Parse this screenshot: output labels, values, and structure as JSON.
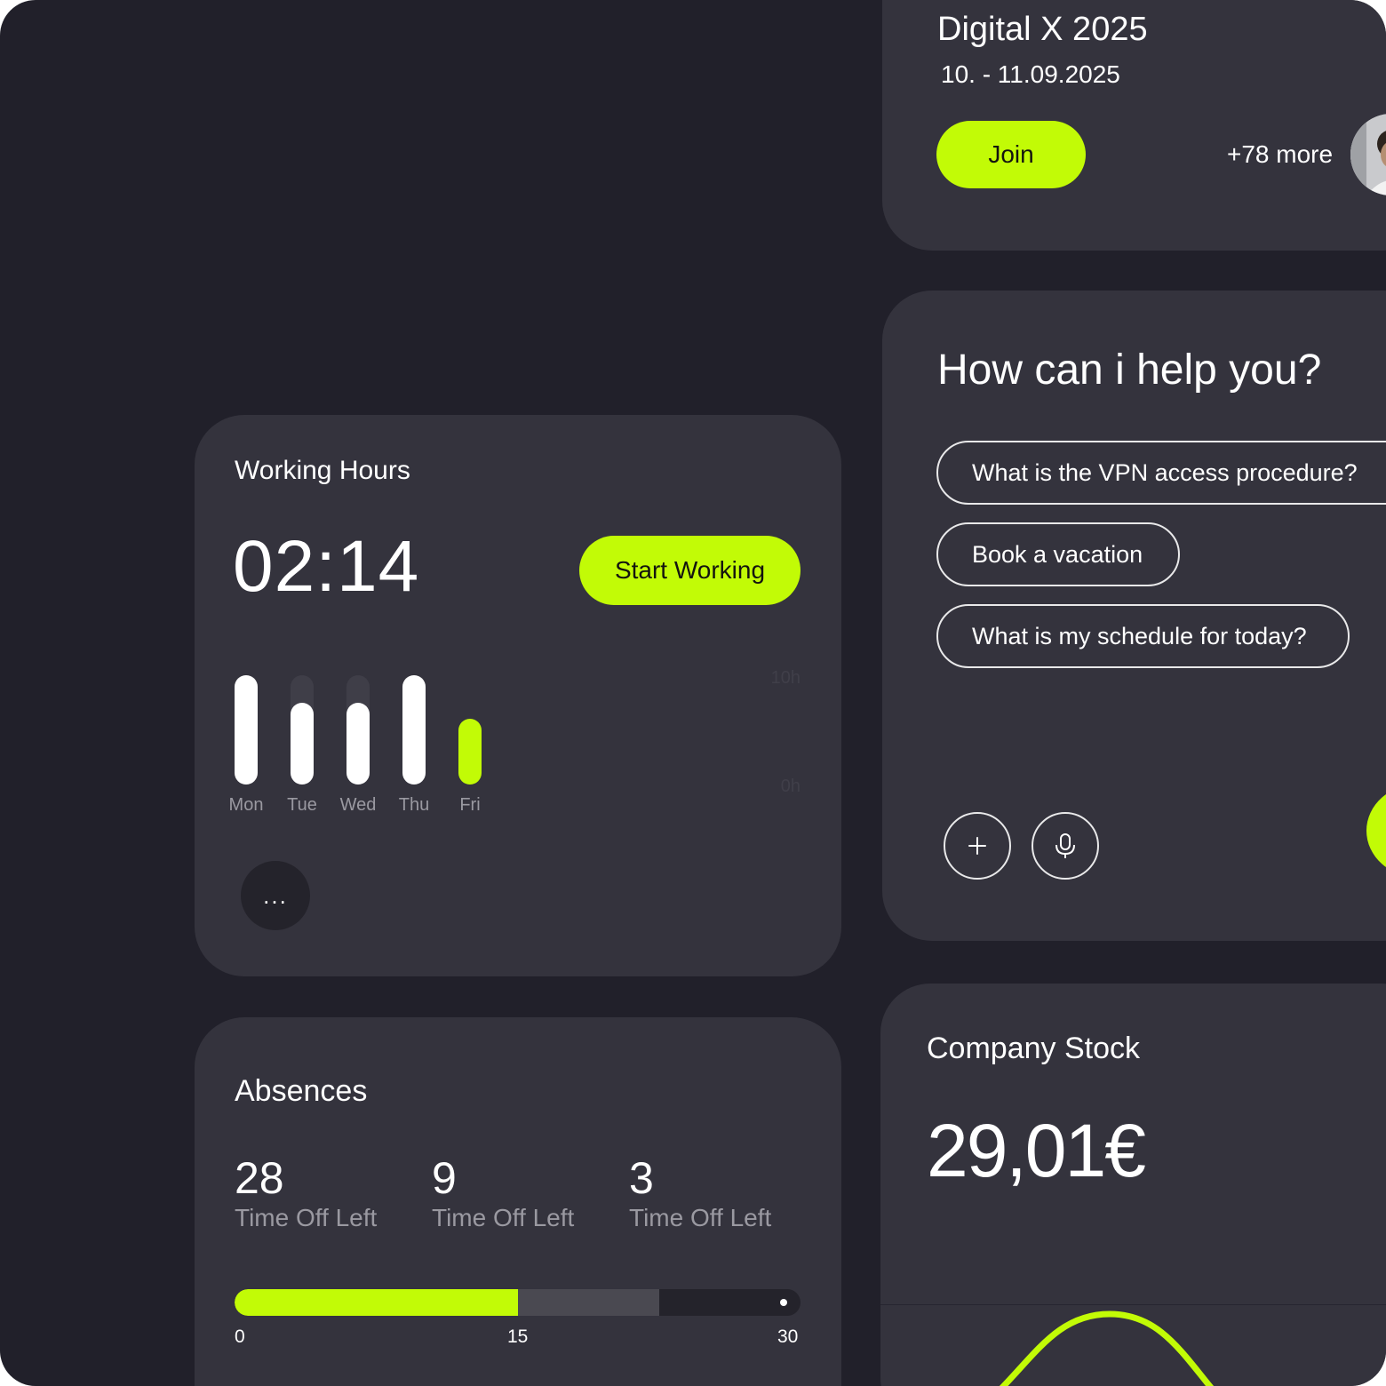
{
  "colors": {
    "background": "#21202a",
    "card": "#34333d",
    "accent": "#c2fb06",
    "muted_text": "#9a99a1",
    "bar_white": "#ffffff"
  },
  "event": {
    "title": "Digital X 2025",
    "date": "10. - 11.09.2025",
    "join_label": "Join",
    "more_attendees": "+78 more"
  },
  "assistant": {
    "title": "How can i help you?",
    "suggestions": [
      "What is the VPN access procedure?",
      "Book a vacation",
      "What is my schedule for today?"
    ],
    "add_icon": "plus-icon",
    "mic_icon": "microphone-icon"
  },
  "working_hours": {
    "title": "Working Hours",
    "time": "02:14",
    "start_label": "Start Working",
    "more_label": "...",
    "axis_max_label": "10h",
    "axis_min_label": "0h",
    "days": [
      {
        "label": "Mon",
        "fraction": 1.0,
        "today": false
      },
      {
        "label": "Tue",
        "fraction": 0.75,
        "today": false
      },
      {
        "label": "Wed",
        "fraction": 0.75,
        "today": false
      },
      {
        "label": "Thu",
        "fraction": 1.0,
        "today": false
      },
      {
        "label": "Fri",
        "fraction": 0.6,
        "today": true
      }
    ]
  },
  "absences": {
    "title": "Absences",
    "stats": [
      {
        "value": "28",
        "label": "Time Off Left"
      },
      {
        "value": "9",
        "label": "Time Off Left"
      },
      {
        "value": "3",
        "label": "Time Off Left"
      }
    ],
    "scale": {
      "min": 0,
      "max": 30
    },
    "scale_labels": [
      "0",
      "15",
      "30"
    ],
    "used_days": 15,
    "planned_days": 22.5
  },
  "stock": {
    "title": "Company Stock",
    "price": "29,01€"
  }
}
